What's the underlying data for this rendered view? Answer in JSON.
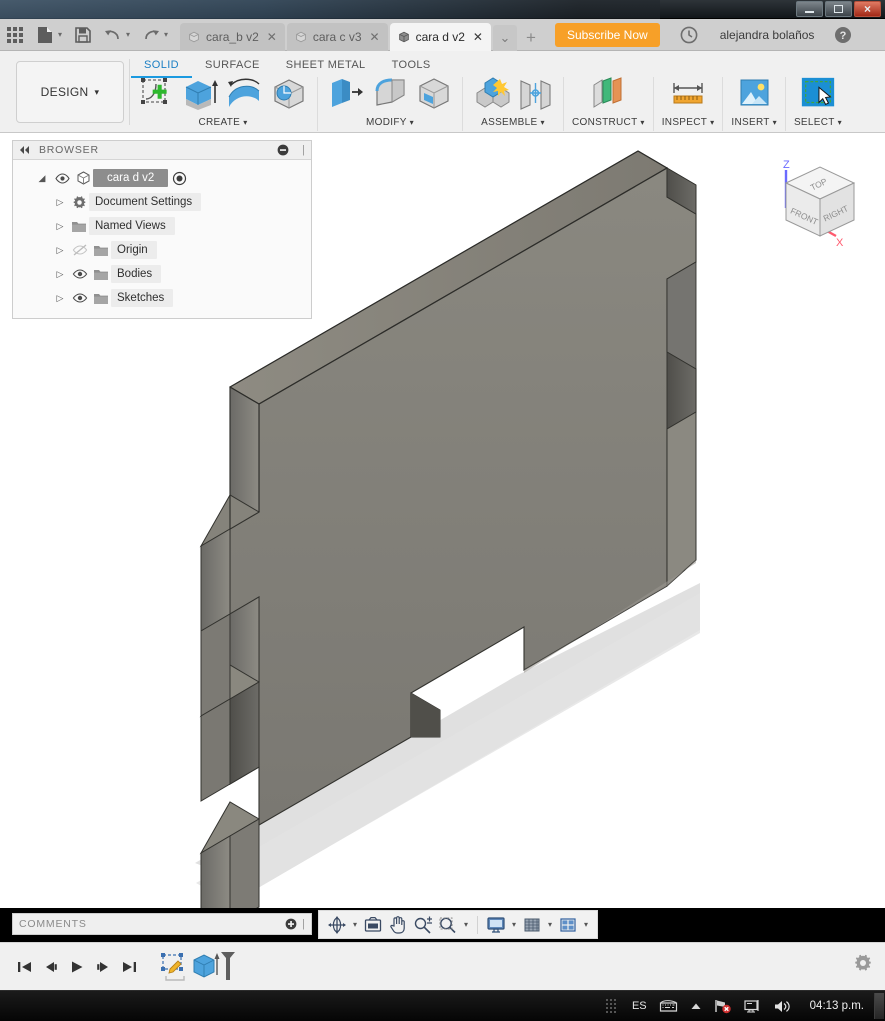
{
  "window": {
    "minimize_label": "Minimize",
    "maximize_label": "Restore",
    "close_label": "×"
  },
  "quickbar": {
    "apps_icon": "grid-apps-icon",
    "new_label": "New",
    "save_label": "Save",
    "undo_label": "Undo",
    "redo_label": "Redo",
    "caret": "▾",
    "subscribe_label": "Subscribe Now",
    "job_status_icon": "clock-icon",
    "username": "alejandra bolaños",
    "help_icon": "help-icon",
    "tab_overflow": "⌄",
    "tab_add": "+"
  },
  "doc_tabs": [
    {
      "label": "cara_b v2",
      "close": "✕",
      "active": false
    },
    {
      "label": "cara c v3",
      "close": "✕",
      "active": false
    },
    {
      "label": "cara d v2",
      "close": "✕",
      "active": true
    }
  ],
  "ribbon": {
    "design_label": "DESIGN",
    "design_caret": "▾",
    "workspace_tabs": [
      {
        "label": "SOLID",
        "active": true
      },
      {
        "label": "SURFACE",
        "active": false
      },
      {
        "label": "SHEET METAL",
        "active": false
      },
      {
        "label": "TOOLS",
        "active": false
      }
    ],
    "panels": [
      {
        "label": "CREATE",
        "caret": "▾"
      },
      {
        "label": "MODIFY",
        "caret": "▾"
      },
      {
        "label": "ASSEMBLE",
        "caret": "▾"
      },
      {
        "label": "CONSTRUCT",
        "caret": "▾"
      },
      {
        "label": "INSPECT",
        "caret": "▾"
      },
      {
        "label": "INSERT",
        "caret": "▾"
      },
      {
        "label": "SELECT",
        "caret": "▾"
      }
    ]
  },
  "browser": {
    "title": "BROWSER",
    "collapse_icon": "collapse-left-icon",
    "options_icon": "minus-circle-icon",
    "root": {
      "label": "cara d v2",
      "expand_arrow": "◢",
      "eye_icon": "eye-visible-icon",
      "component_icon": "component-icon",
      "activate_icon": "radio-activated-icon"
    },
    "nodes": [
      {
        "label": "Document Settings",
        "arrow": "▷",
        "icon": "gear-icon",
        "eye": false
      },
      {
        "label": "Named Views",
        "arrow": "▷",
        "icon": "folder-icon",
        "eye": false
      },
      {
        "label": "Origin",
        "arrow": "▷",
        "icon": "folder-icon",
        "eye": true,
        "eye_state": "hidden"
      },
      {
        "label": "Bodies",
        "arrow": "▷",
        "icon": "folder-icon",
        "eye": true,
        "eye_state": "visible"
      },
      {
        "label": "Sketches",
        "arrow": "▷",
        "icon": "folder-icon",
        "eye": true,
        "eye_state": "visible"
      }
    ]
  },
  "viewcube": {
    "top_label": "TOP",
    "front_label": "FRONT",
    "right_label": "RIGHT",
    "axis_z": "Z",
    "axis_x": "X",
    "z_color": "#6a6aff",
    "x_color": "#ff5a6e"
  },
  "model": {
    "name": "cara d v2 body",
    "description": "Flat rectangular panel with finger-joint tabs on the left edge and matching notches on the right edge, shown in isometric view",
    "face_color": "#7f7d77",
    "top_color": "#8b8880",
    "side_color": "#71706c",
    "shadow_color": "#d9d9d9",
    "edge_color": "#33332f"
  },
  "comments": {
    "title": "COMMENTS",
    "add_icon": "add-comment-icon"
  },
  "navbar": {
    "buttons": [
      {
        "name": "orbit-icon",
        "caret": "▾"
      },
      {
        "name": "look-at-icon",
        "caret": ""
      },
      {
        "name": "pan-icon",
        "caret": ""
      },
      {
        "name": "zoom-icon",
        "caret": ""
      },
      {
        "name": "fit-icon",
        "caret": "▾"
      },
      {
        "name": "display-settings-icon",
        "caret": "▾"
      },
      {
        "name": "grid-snaps-icon",
        "caret": "▾"
      },
      {
        "name": "viewport-layout-icon",
        "caret": "▾"
      }
    ]
  },
  "timeline": {
    "controls": [
      {
        "name": "go-to-beginning-icon",
        "glyph": "|◀"
      },
      {
        "name": "step-back-icon",
        "glyph": "◀|"
      },
      {
        "name": "play-icon",
        "glyph": "▶"
      },
      {
        "name": "step-forward-icon",
        "glyph": "|▶"
      },
      {
        "name": "go-to-end-icon",
        "glyph": "▶|"
      }
    ],
    "features": [
      {
        "name": "sketch-feature-icon",
        "label": "Sketch"
      },
      {
        "name": "extrude-feature-icon",
        "label": "Extrude"
      }
    ],
    "end_marker": "timeline-end-marker",
    "settings_icon": "gear-icon"
  },
  "taskbar": {
    "language": "ES",
    "keyboard_icon": "keyboard-icon",
    "show_hidden_icon": "chevron-up-icon",
    "network_icon": "network-error-icon",
    "monitor_icon": "display-icon",
    "volume_icon": "volume-icon",
    "clock": "04:13 p.m.",
    "show_desktop": "show-desktop-button"
  }
}
